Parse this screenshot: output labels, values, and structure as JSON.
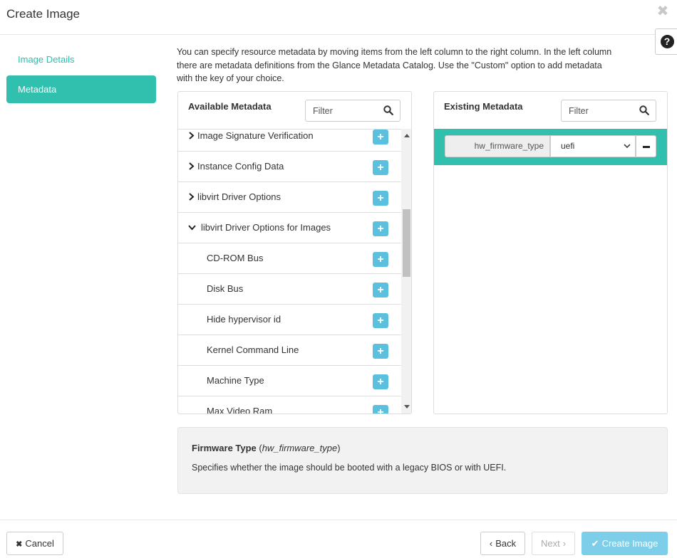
{
  "dialog": {
    "title": "Create Image",
    "close_glyph": "✖",
    "help_glyph": "?"
  },
  "nav": {
    "items": [
      {
        "label": "Image Details",
        "active": false
      },
      {
        "label": "Metadata",
        "active": true
      }
    ]
  },
  "intro": "You can specify resource metadata by moving items from the left column to the right column. In the left column there are metadata definitions from the Glance Metadata Catalog. Use the \"Custom\" option to add metadata with the key of your choice.",
  "available": {
    "title": "Available Metadata",
    "filter_placeholder": "Filter",
    "items": [
      {
        "label": "Image Signature Verification"
      },
      {
        "label": "Instance Config Data"
      },
      {
        "label": "libvirt Driver Options"
      },
      {
        "label": "libvirt Driver Options for Images"
      },
      {
        "label": "CD-ROM Bus"
      },
      {
        "label": "Disk Bus"
      },
      {
        "label": "Hide hypervisor id"
      },
      {
        "label": "Kernel Command Line"
      },
      {
        "label": "Machine Type"
      },
      {
        "label": "Max Video Ram"
      }
    ]
  },
  "existing": {
    "title": "Existing Metadata",
    "filter_placeholder": "Filter",
    "item": {
      "key": "hw_firmware_type",
      "value": "uefi"
    }
  },
  "description": {
    "name": "Firmware Type",
    "key": "hw_firmware_type",
    "text": "Specifies whether the image should be booted with a legacy BIOS or with UEFI."
  },
  "footer": {
    "cancel": "Cancel",
    "back": "Back",
    "next": "Next",
    "create": "Create Image"
  },
  "colors": {
    "accent": "#31bfae",
    "add_button": "#5bc0de",
    "primary_disabled": "#7dcfe9"
  }
}
